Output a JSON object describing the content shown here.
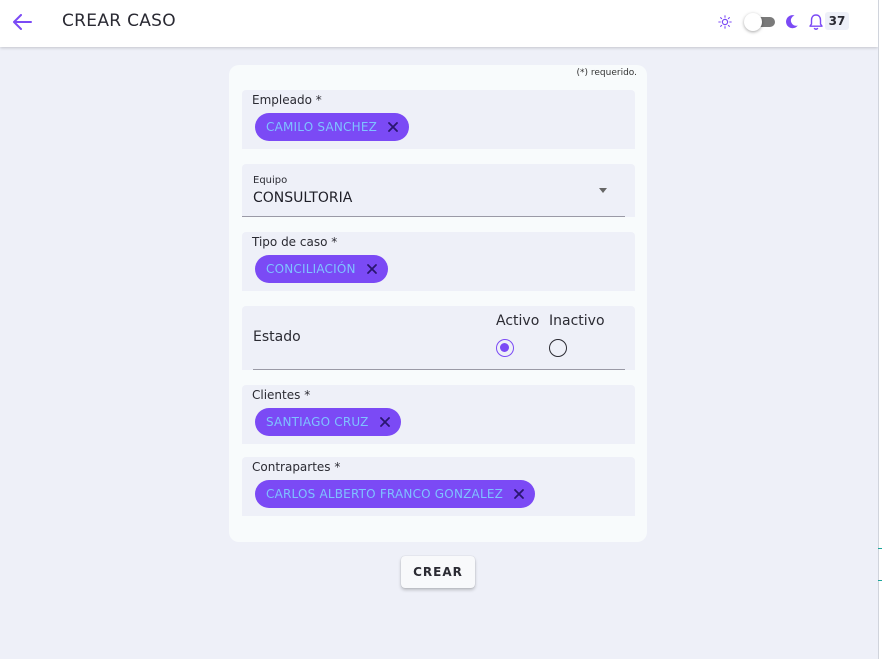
{
  "header": {
    "title": "CREAR CASO",
    "notification_count": "37"
  },
  "colors": {
    "accent": "#7b4af5",
    "chip_text": "#7ec2ff",
    "background": "#eef0f8"
  },
  "icons": [
    "back-arrow-icon",
    "sun-icon",
    "moon-icon",
    "bell-icon",
    "close-icon",
    "chevron-down-icon"
  ],
  "form": {
    "required_note": "(*) requerido.",
    "empleado": {
      "label": "Empleado *",
      "chips": [
        "CAMILO SANCHEZ"
      ]
    },
    "equipo": {
      "label": "Equipo",
      "value": "CONSULTORIA"
    },
    "tipo_caso": {
      "label": "Tipo de caso *",
      "chips": [
        "CONCILIACIÓN"
      ]
    },
    "estado": {
      "label": "Estado",
      "options": [
        "Activo",
        "Inactivo"
      ],
      "selected": "Activo"
    },
    "clientes": {
      "label": "Clientes *",
      "chips": [
        "SANTIAGO CRUZ"
      ]
    },
    "contrapartes": {
      "label": "Contrapartes *",
      "chips": [
        "CARLOS ALBERTO FRANCO GONZALEZ"
      ]
    },
    "submit_label": "CREAR"
  }
}
